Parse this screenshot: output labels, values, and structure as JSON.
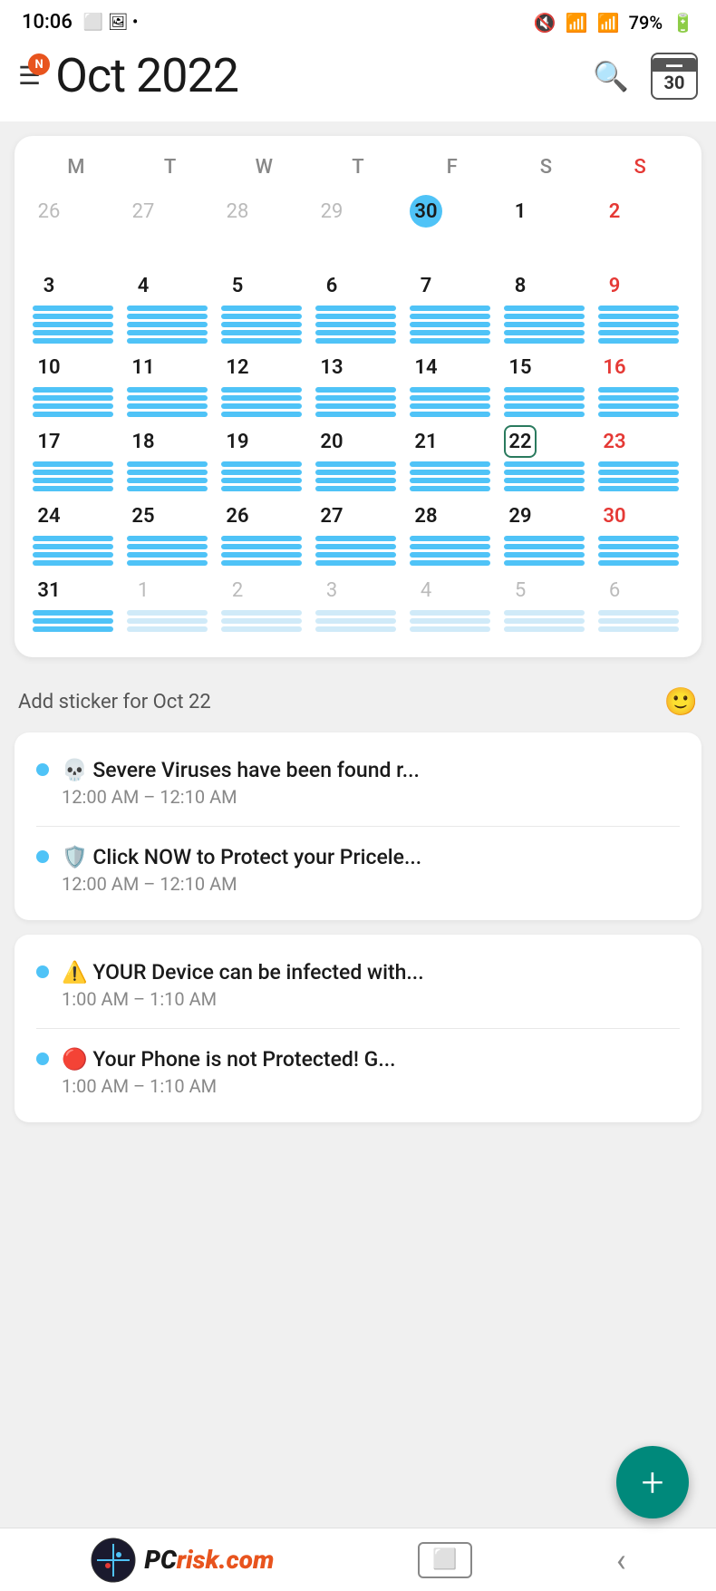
{
  "status": {
    "time": "10:06",
    "battery": "79%"
  },
  "header": {
    "notification_label": "N",
    "title": "Oct  2022",
    "today_date": "30"
  },
  "calendar": {
    "day_headers": [
      "M",
      "T",
      "W",
      "T",
      "F",
      "S",
      "S"
    ],
    "weeks": [
      [
        {
          "date": "26",
          "faded": true,
          "sunday": false,
          "today": false,
          "selected": false,
          "events": 0
        },
        {
          "date": "27",
          "faded": true,
          "sunday": false,
          "today": false,
          "selected": false,
          "events": 0
        },
        {
          "date": "28",
          "faded": true,
          "sunday": false,
          "today": false,
          "selected": false,
          "events": 0
        },
        {
          "date": "29",
          "faded": true,
          "sunday": false,
          "today": false,
          "selected": false,
          "events": 0
        },
        {
          "date": "30",
          "faded": false,
          "sunday": false,
          "today": true,
          "selected": false,
          "events": 0
        },
        {
          "date": "1",
          "faded": false,
          "sunday": false,
          "today": false,
          "selected": false,
          "events": 0
        },
        {
          "date": "2",
          "faded": false,
          "sunday": true,
          "today": false,
          "selected": false,
          "events": 0
        }
      ],
      [
        {
          "date": "3",
          "faded": false,
          "sunday": false,
          "today": false,
          "selected": false,
          "events": 5
        },
        {
          "date": "4",
          "faded": false,
          "sunday": false,
          "today": false,
          "selected": false,
          "events": 5
        },
        {
          "date": "5",
          "faded": false,
          "sunday": false,
          "today": false,
          "selected": false,
          "events": 5
        },
        {
          "date": "6",
          "faded": false,
          "sunday": false,
          "today": false,
          "selected": false,
          "events": 5
        },
        {
          "date": "7",
          "faded": false,
          "sunday": false,
          "today": false,
          "selected": false,
          "events": 5
        },
        {
          "date": "8",
          "faded": false,
          "sunday": false,
          "today": false,
          "selected": false,
          "events": 5
        },
        {
          "date": "9",
          "faded": false,
          "sunday": true,
          "today": false,
          "selected": false,
          "events": 5
        }
      ],
      [
        {
          "date": "10",
          "faded": false,
          "sunday": false,
          "today": false,
          "selected": false,
          "events": 4
        },
        {
          "date": "11",
          "faded": false,
          "sunday": false,
          "today": false,
          "selected": false,
          "events": 4
        },
        {
          "date": "12",
          "faded": false,
          "sunday": false,
          "today": false,
          "selected": false,
          "events": 4
        },
        {
          "date": "13",
          "faded": false,
          "sunday": false,
          "today": false,
          "selected": false,
          "events": 4
        },
        {
          "date": "14",
          "faded": false,
          "sunday": false,
          "today": false,
          "selected": false,
          "events": 4
        },
        {
          "date": "15",
          "faded": false,
          "sunday": false,
          "today": false,
          "selected": false,
          "events": 4
        },
        {
          "date": "16",
          "faded": false,
          "sunday": true,
          "today": false,
          "selected": false,
          "events": 4
        }
      ],
      [
        {
          "date": "17",
          "faded": false,
          "sunday": false,
          "today": false,
          "selected": false,
          "events": 4
        },
        {
          "date": "18",
          "faded": false,
          "sunday": false,
          "today": false,
          "selected": false,
          "events": 4
        },
        {
          "date": "19",
          "faded": false,
          "sunday": false,
          "today": false,
          "selected": false,
          "events": 4
        },
        {
          "date": "20",
          "faded": false,
          "sunday": false,
          "today": false,
          "selected": false,
          "events": 4
        },
        {
          "date": "21",
          "faded": false,
          "sunday": false,
          "today": false,
          "selected": false,
          "events": 4
        },
        {
          "date": "22",
          "faded": false,
          "sunday": false,
          "today": false,
          "selected": true,
          "events": 4
        },
        {
          "date": "23",
          "faded": false,
          "sunday": true,
          "today": false,
          "selected": false,
          "events": 4
        }
      ],
      [
        {
          "date": "24",
          "faded": false,
          "sunday": false,
          "today": false,
          "selected": false,
          "events": 4
        },
        {
          "date": "25",
          "faded": false,
          "sunday": false,
          "today": false,
          "selected": false,
          "events": 4
        },
        {
          "date": "26",
          "faded": false,
          "sunday": false,
          "today": false,
          "selected": false,
          "events": 4
        },
        {
          "date": "27",
          "faded": false,
          "sunday": false,
          "today": false,
          "selected": false,
          "events": 4
        },
        {
          "date": "28",
          "faded": false,
          "sunday": false,
          "today": false,
          "selected": false,
          "events": 4
        },
        {
          "date": "29",
          "faded": false,
          "sunday": false,
          "today": false,
          "selected": false,
          "events": 4
        },
        {
          "date": "30",
          "faded": false,
          "sunday": true,
          "today": false,
          "selected": false,
          "events": 4
        }
      ],
      [
        {
          "date": "31",
          "faded": false,
          "sunday": false,
          "today": false,
          "selected": false,
          "events": 3
        },
        {
          "date": "1",
          "faded": true,
          "sunday": false,
          "today": false,
          "selected": false,
          "events": 3
        },
        {
          "date": "2",
          "faded": true,
          "sunday": false,
          "today": false,
          "selected": false,
          "events": 3
        },
        {
          "date": "3",
          "faded": true,
          "sunday": false,
          "today": false,
          "selected": false,
          "events": 3
        },
        {
          "date": "4",
          "faded": true,
          "sunday": false,
          "today": false,
          "selected": false,
          "events": 3
        },
        {
          "date": "5",
          "faded": true,
          "sunday": false,
          "today": false,
          "selected": false,
          "events": 3
        },
        {
          "date": "6",
          "faded": true,
          "sunday": true,
          "today": false,
          "selected": false,
          "events": 3
        }
      ]
    ]
  },
  "sticker_row": {
    "label": "Add sticker for Oct 22"
  },
  "events_group_1": [
    {
      "title": "💀 Severe Viruses have been found r...",
      "time": "12:00 AM – 12:10 AM"
    },
    {
      "title": "🛡️ Click NOW to Protect your Pricele...",
      "time": "12:00 AM – 12:10 AM"
    }
  ],
  "events_group_2": [
    {
      "title": "⚠️ YOUR Device can be infected with...",
      "time": "1:00 AM – 1:10 AM"
    },
    {
      "title": "🔴 Your Phone is not Protected! G...",
      "time": "1:00 AM – 1:10 AM"
    }
  ],
  "fab": {
    "label": "+"
  },
  "bottom_bar": {
    "brand_pc": "PC",
    "brand_rest": "risk.com"
  }
}
